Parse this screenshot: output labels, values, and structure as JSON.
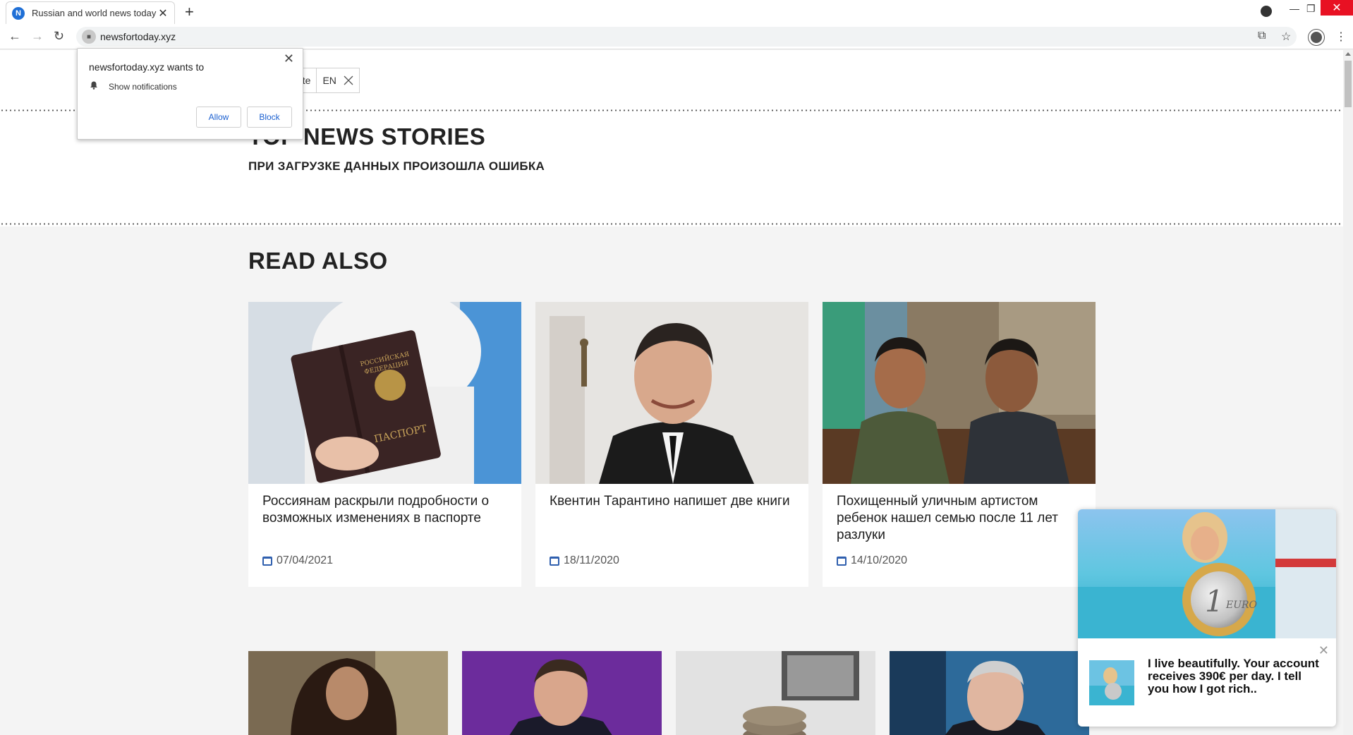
{
  "browser": {
    "tab_title": "Russian and world news today",
    "tab_favicon_letter": "N",
    "url": "newsfortoday.xyz",
    "accent": "#1f6fd6"
  },
  "notification_prompt": {
    "title": "newsfortoday.xyz wants to",
    "item": "Show notifications",
    "allow_label": "Allow",
    "block_label": "Block"
  },
  "lang_selector": {
    "translate_label": "ate",
    "current": "EN"
  },
  "top_news": {
    "heading": "TOP NEWS STORIES",
    "error": "ПРИ ЗАГРУЗКЕ ДАННЫХ ПРОИЗОШЛА ОШИБКА"
  },
  "read_also": {
    "heading": "READ ALSO",
    "cards": [
      {
        "headline": "Россиянам раскрыли подробности о возможных изменениях в паспорте",
        "date": "07/04/2021"
      },
      {
        "headline": "Квентин Тарантино напишет две книги",
        "date": "18/11/2020"
      },
      {
        "headline": "Похищенный уличным артистом ребенок нашел семью после 11 лет разлуки",
        "date": "14/10/2020"
      }
    ]
  },
  "ad": {
    "text": "I live beautifully. Your account receives 390€ per day. I tell you how I got rich..",
    "coin_label": "EURO",
    "coin_value": "1"
  },
  "passport_lines": [
    "РОССИЙСКАЯ",
    "ФЕДЕРАЦИЯ",
    "ПАСПОРТ"
  ]
}
